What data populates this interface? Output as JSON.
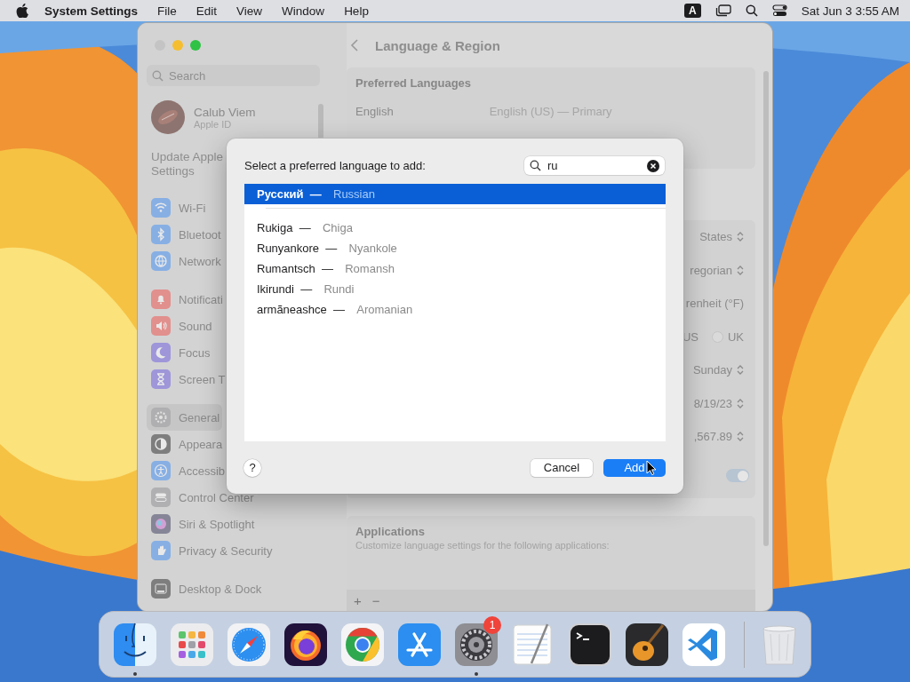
{
  "menu_bar": {
    "app_name": "System Settings",
    "menus": [
      "File",
      "Edit",
      "View",
      "Window",
      "Help"
    ],
    "input_source": "A",
    "clock": "Sat Jun 3 3:55 AM"
  },
  "settings": {
    "search": {
      "placeholder": "Search"
    },
    "account": {
      "name": "Calub Viem",
      "subtitle": "Apple ID"
    },
    "notice": "Update Apple Settings",
    "sidebar": {
      "groups": [
        [
          {
            "label": "Wi-Fi",
            "kind": "wifi",
            "selected": false
          },
          {
            "label": "Bluetoot",
            "kind": "bluetooth",
            "selected": false
          },
          {
            "label": "Network",
            "kind": "network",
            "selected": false
          }
        ],
        [
          {
            "label": "Notificati",
            "kind": "notifications",
            "selected": false
          },
          {
            "label": "Sound",
            "kind": "sound",
            "selected": false
          },
          {
            "label": "Focus",
            "kind": "focus",
            "selected": false
          },
          {
            "label": "Screen T",
            "kind": "screen_time",
            "selected": false
          }
        ],
        [
          {
            "label": "General",
            "kind": "general",
            "selected": true
          },
          {
            "label": "Appeara",
            "kind": "appearance",
            "selected": false
          },
          {
            "label": "Accessib",
            "kind": "accessibility",
            "selected": false
          },
          {
            "label": "Control Center",
            "kind": "control_center",
            "selected": false
          },
          {
            "label": "Siri & Spotlight",
            "kind": "siri",
            "selected": false
          },
          {
            "label": "Privacy & Security",
            "kind": "privacy",
            "selected": false
          }
        ],
        [
          {
            "label": "Desktop & Dock",
            "kind": "desktop",
            "selected": false
          }
        ]
      ]
    },
    "title": "Language & Region",
    "preferred_languages": {
      "heading": "Preferred Languages",
      "rows": [
        {
          "language": "English",
          "detail": "English (US) — Primary"
        }
      ]
    },
    "region_values": [
      {
        "kind": "popup",
        "value": "States"
      },
      {
        "kind": "popup",
        "value": "regorian"
      },
      {
        "kind": "text",
        "value": "renheit (°F)"
      },
      {
        "kind": "radio",
        "label": "US",
        "options": [
          {
            "label": "UK",
            "selected": false
          }
        ]
      },
      {
        "kind": "popup",
        "value": "Sunday"
      },
      {
        "kind": "popup",
        "value": "8/19/23"
      },
      {
        "kind": "popup",
        "value": ",567.89"
      },
      {
        "kind": "toggle",
        "on": true
      }
    ],
    "applications": {
      "heading": "Applications",
      "description": "Customize language settings for the following applications:",
      "buttons": [
        "+",
        "−"
      ]
    }
  },
  "dialog": {
    "prompt": "Select a preferred language to add:",
    "search": {
      "value": "ru"
    },
    "groups": [
      [
        {
          "native": "Русский",
          "dash": "—",
          "english": "Russian",
          "selected": true
        }
      ],
      [
        {
          "native": "Rukiga",
          "dash": "—",
          "english": "Chiga",
          "selected": false
        },
        {
          "native": "Runyankore",
          "dash": "—",
          "english": "Nyankole",
          "selected": false
        },
        {
          "native": "Rumantsch",
          "dash": "—",
          "english": "Romansh",
          "selected": false
        },
        {
          "native": "Ikirundi",
          "dash": "—",
          "english": "Rundi",
          "selected": false
        },
        {
          "native": "armãneashce",
          "dash": "—",
          "english": "Aromanian",
          "selected": false
        }
      ]
    ],
    "help": "?",
    "buttons": [
      {
        "label": "Cancel",
        "kind": "secondary"
      },
      {
        "label": "Add",
        "kind": "primary"
      }
    ]
  },
  "dock": {
    "items": [
      {
        "kind": "finder",
        "running": true
      },
      {
        "kind": "launchpad",
        "running": false
      },
      {
        "kind": "safari",
        "running": false
      },
      {
        "kind": "firefox",
        "running": false
      },
      {
        "kind": "chrome",
        "running": false
      },
      {
        "kind": "appstore",
        "running": false
      },
      {
        "kind": "settings",
        "running": true,
        "badge": "1"
      },
      {
        "kind": "textedit",
        "running": false
      },
      {
        "kind": "terminal",
        "running": false
      },
      {
        "kind": "garageband",
        "running": false
      },
      {
        "kind": "vscode",
        "running": false
      },
      {
        "kind": "trash",
        "running": false
      }
    ]
  }
}
